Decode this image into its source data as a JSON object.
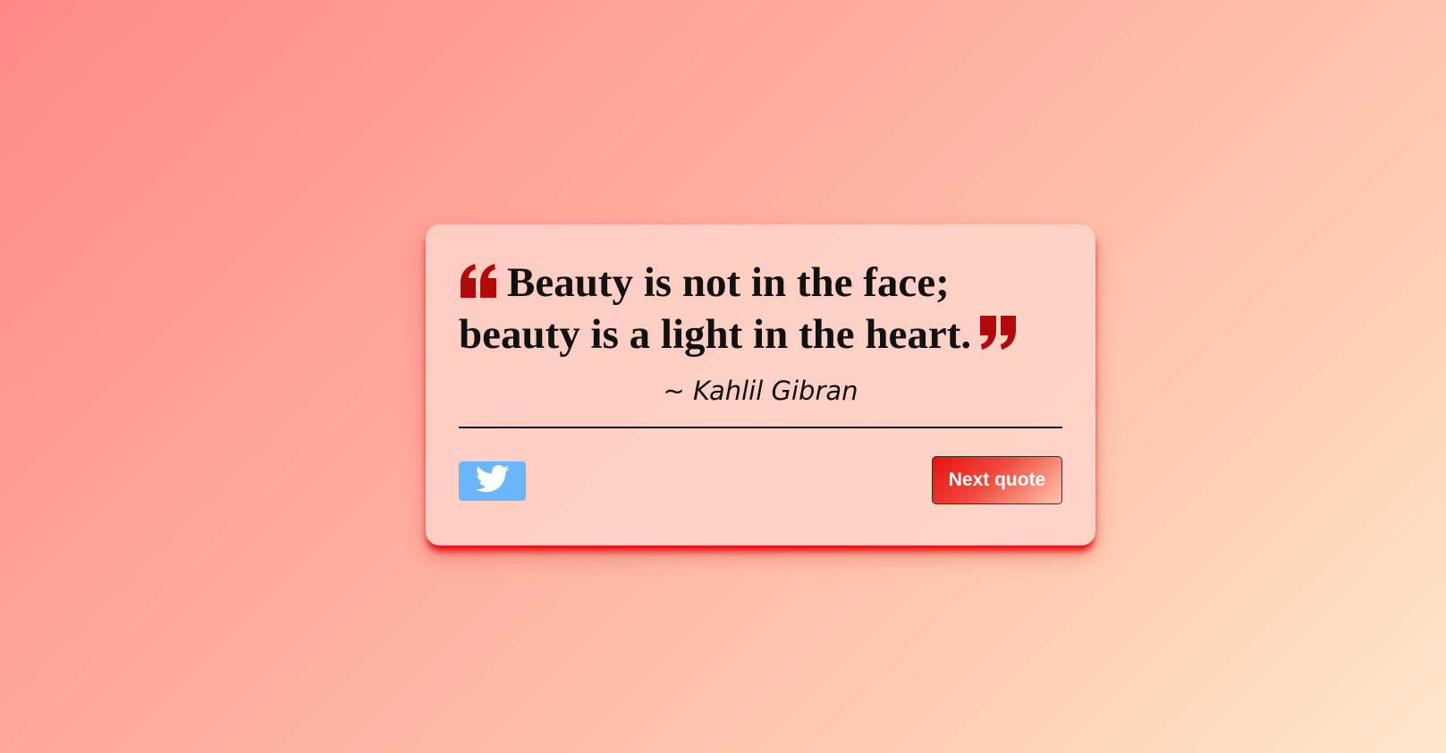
{
  "quote": {
    "text": "Beauty is not in the face; beauty is a light in the heart.",
    "author": "~ Kahlil Gibran"
  },
  "actions": {
    "tweet_icon": "twitter-icon",
    "next_label": "Next quote"
  },
  "colors": {
    "quote_mark": "#b20a0a",
    "tweet_button": "#6bb6ff",
    "card_shadow": "#e60000"
  }
}
